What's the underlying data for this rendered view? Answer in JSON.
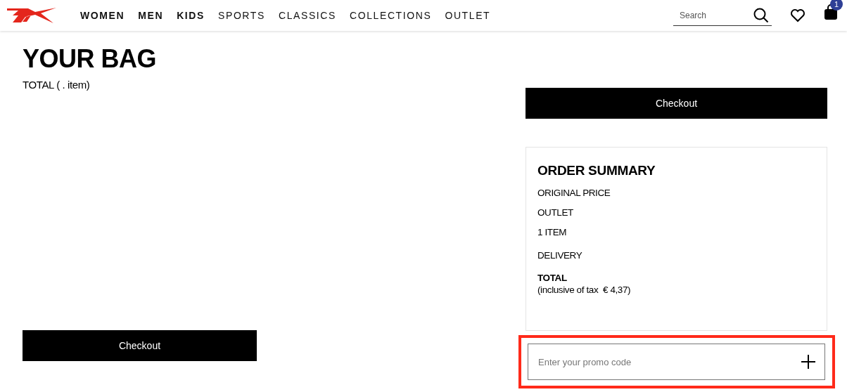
{
  "nav": {
    "items": [
      {
        "label": "WOMEN",
        "emphasized": true
      },
      {
        "label": "MEN",
        "emphasized": true
      },
      {
        "label": "KIDS",
        "emphasized": true
      },
      {
        "label": "SPORTS",
        "emphasized": false
      },
      {
        "label": "CLASSICS",
        "emphasized": false
      },
      {
        "label": "COLLECTIONS",
        "emphasized": false
      },
      {
        "label": "OUTLET",
        "emphasized": false
      }
    ],
    "search": {
      "placeholder": "Search"
    },
    "cart_badge": "1"
  },
  "bag": {
    "title": "YOUR BAG",
    "total": "TOTAL ( . item)",
    "checkout": "Checkout"
  },
  "summary": {
    "checkout": "Checkout",
    "title": "ORDER SUMMARY",
    "lines": [
      {
        "label": "ORIGINAL PRICE",
        "bold": false
      },
      {
        "label": "OUTLET",
        "bold": false
      },
      {
        "label": "1 ITEM",
        "bold": false
      },
      {
        "label": "DELIVERY",
        "bold": false
      },
      {
        "label": "TOTAL",
        "bold": true
      }
    ],
    "tax_note": "(inclusive of tax  € 4,37)",
    "promo": {
      "placeholder": "Enter your promo code",
      "highlighted": true
    }
  }
}
